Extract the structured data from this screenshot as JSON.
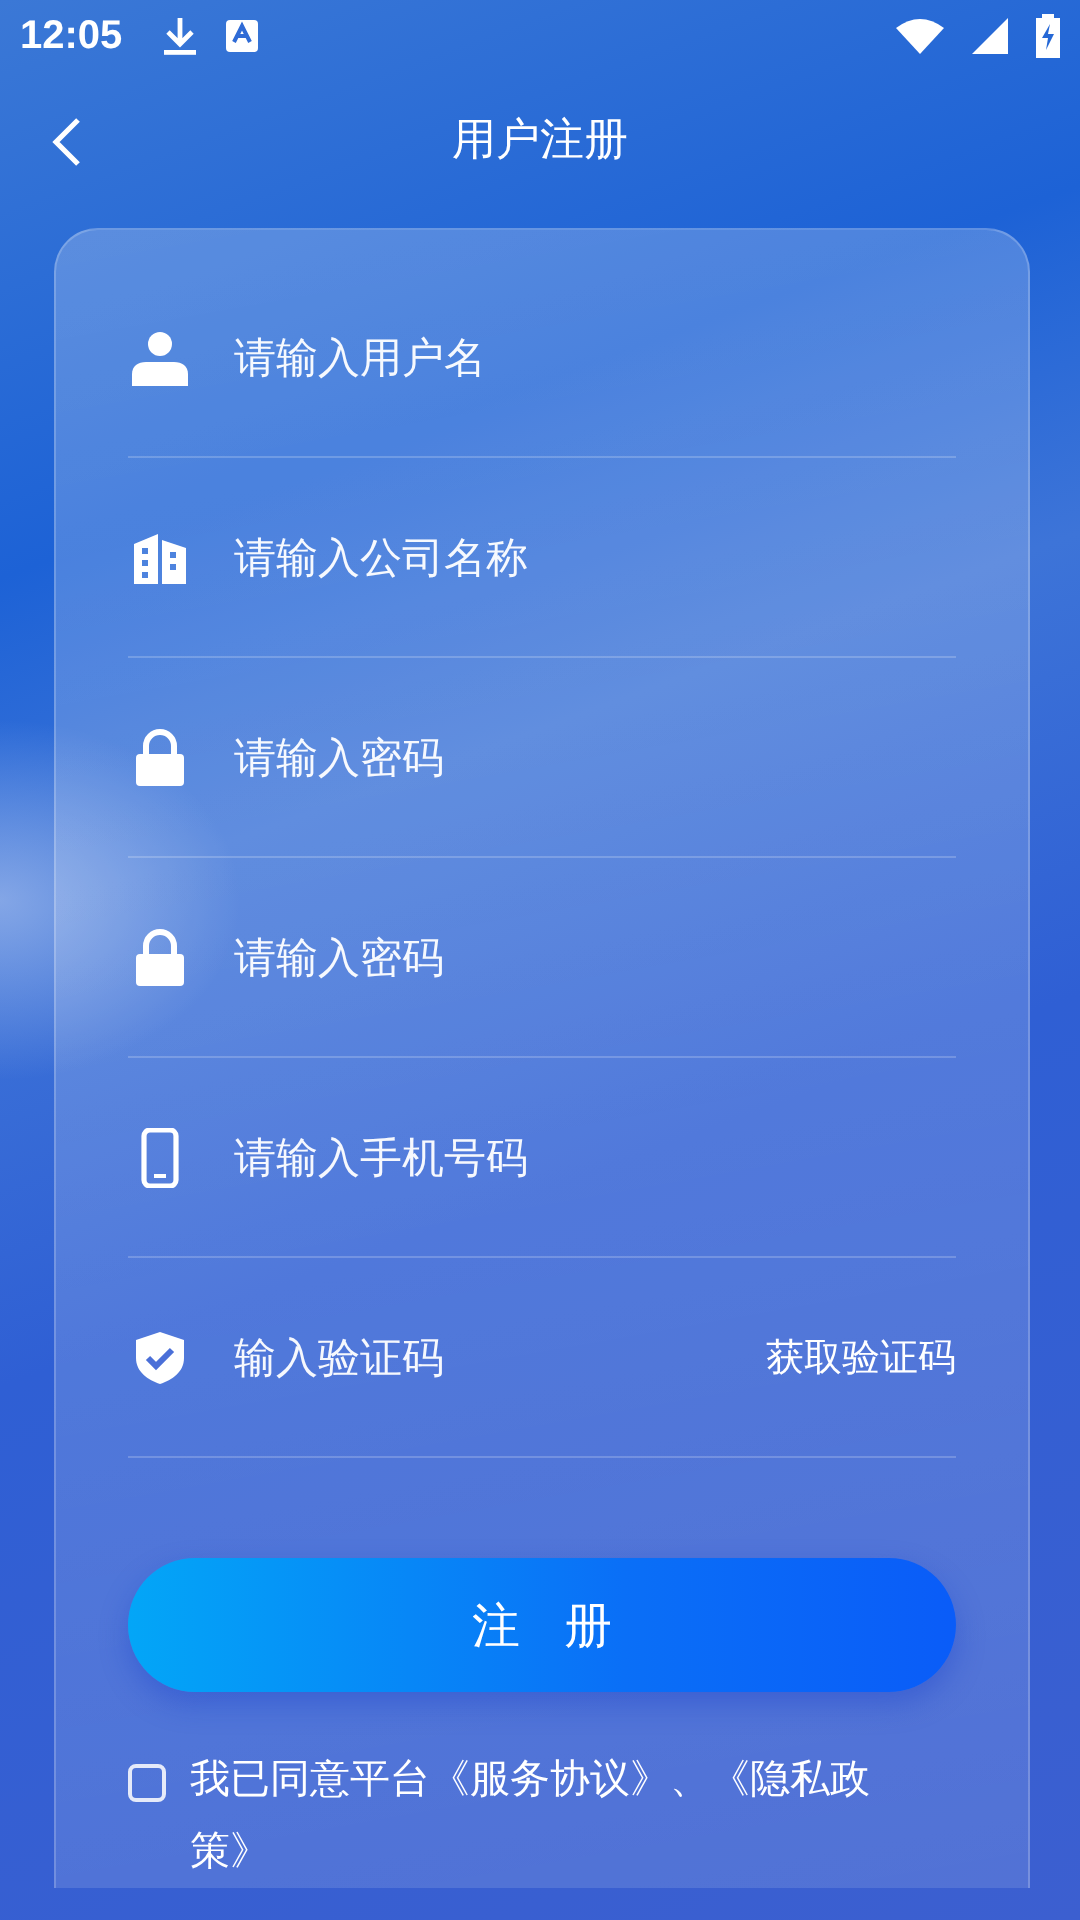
{
  "status_bar": {
    "time": "12:05"
  },
  "header": {
    "title": "用户注册"
  },
  "fields": [
    {
      "kind": "user",
      "placeholder": "请输入用户名"
    },
    {
      "kind": "company",
      "placeholder": "请输入公司名称"
    },
    {
      "kind": "password",
      "placeholder": "请输入密码"
    },
    {
      "kind": "password",
      "placeholder": "请输入密码"
    },
    {
      "kind": "phone",
      "placeholder": "请输入手机号码"
    },
    {
      "kind": "code",
      "placeholder": "输入验证码",
      "action": "获取验证码"
    }
  ],
  "submit": {
    "label": "注 册"
  },
  "agreement": {
    "checked": false,
    "text": "我已同意平台《服务协议》、《隐私政策》"
  }
}
